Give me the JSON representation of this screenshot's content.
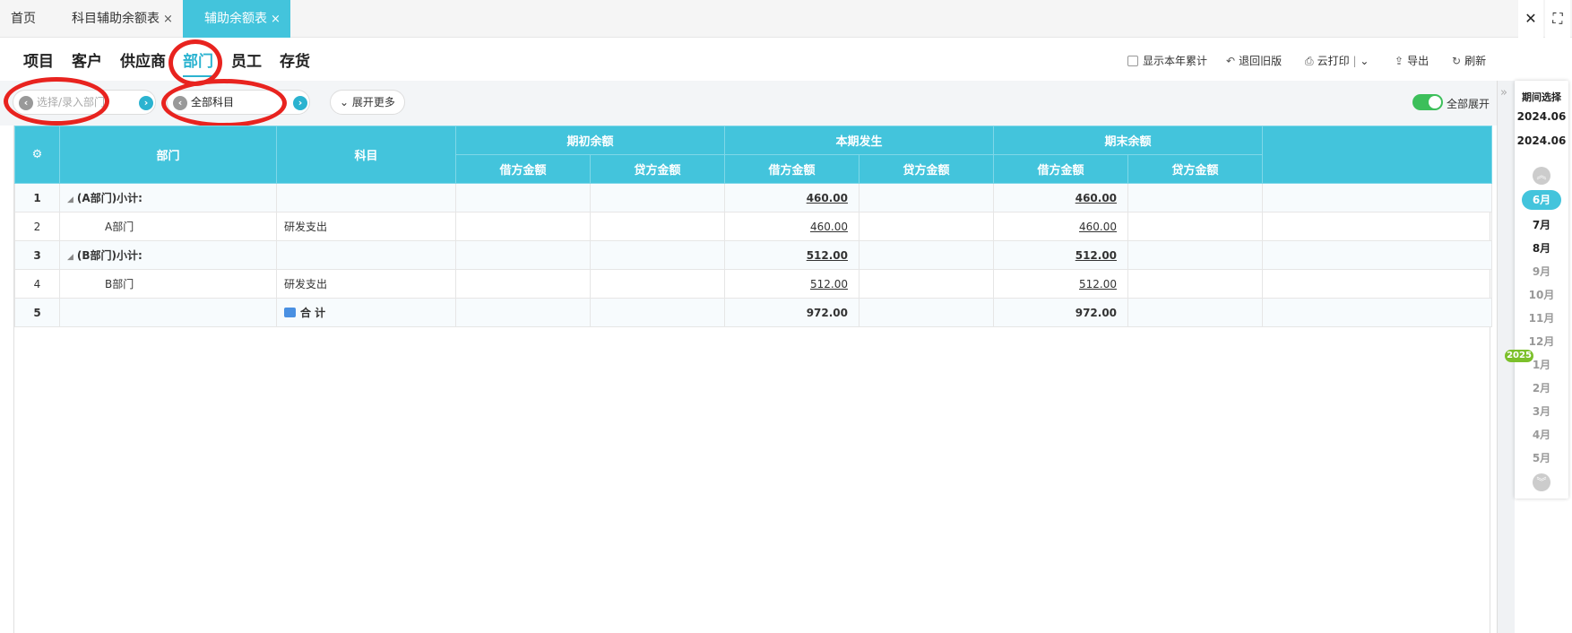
{
  "tabs": [
    {
      "label": "首页"
    },
    {
      "label": "科目辅助余额表",
      "close": "×"
    },
    {
      "label": "辅助余额表",
      "close": "×"
    }
  ],
  "window": {
    "close": "✕",
    "fullscreen": "⛶"
  },
  "categories": [
    "项目",
    "客户",
    "供应商",
    "部门",
    "员工",
    "存货"
  ],
  "active_category": "部门",
  "toolbar": {
    "show_year_total": "显示本年累计",
    "back_old": "退回旧版",
    "cloud_print": "云打印",
    "export": "导出",
    "refresh": "刷新"
  },
  "filters": {
    "dept_placeholder": "选择/录入部门",
    "subject_value": "全部科目",
    "expand_more": "展开更多",
    "expand_all": "全部展开"
  },
  "table": {
    "headers": {
      "dept": "部门",
      "subject": "科目",
      "opening": "期初余额",
      "current": "本期发生",
      "closing": "期末余额",
      "debit": "借方金额",
      "credit": "贷方金额"
    },
    "rows": [
      {
        "idx": "1",
        "dept": "(A部门)小计:",
        "subject": "",
        "op_d": "",
        "op_c": "",
        "cur_d": "460.00",
        "cur_c": "",
        "cl_d": "460.00",
        "cl_c": ""
      },
      {
        "idx": "2",
        "dept": "A部门",
        "subject": "研发支出",
        "op_d": "",
        "op_c": "",
        "cur_d": "460.00",
        "cur_c": "",
        "cl_d": "460.00",
        "cl_c": ""
      },
      {
        "idx": "3",
        "dept": "(B部门)小计:",
        "subject": "",
        "op_d": "",
        "op_c": "",
        "cur_d": "512.00",
        "cur_c": "",
        "cl_d": "512.00",
        "cl_c": ""
      },
      {
        "idx": "4",
        "dept": "B部门",
        "subject": "研发支出",
        "op_d": "",
        "op_c": "",
        "cur_d": "512.00",
        "cur_c": "",
        "cl_d": "512.00",
        "cl_c": ""
      },
      {
        "idx": "5",
        "dept": "",
        "subject": "合 计",
        "op_d": "",
        "op_c": "",
        "cur_d": "972.00",
        "cur_c": "",
        "cl_d": "972.00",
        "cl_c": ""
      }
    ]
  },
  "period": {
    "title": "期间选择",
    "start": "2024.06",
    "end": "2024.06",
    "months": [
      "6月",
      "7月",
      "8月",
      "9月",
      "10月",
      "11月",
      "12月",
      "1月",
      "2月",
      "3月",
      "4月",
      "5月"
    ],
    "selected": "6月",
    "year_badge": "2025"
  },
  "colors": {
    "accent": "#43c4dc",
    "annotation": "#e8231f",
    "toggle_on": "#3cbf5a",
    "year_badge": "#7cc02b"
  }
}
